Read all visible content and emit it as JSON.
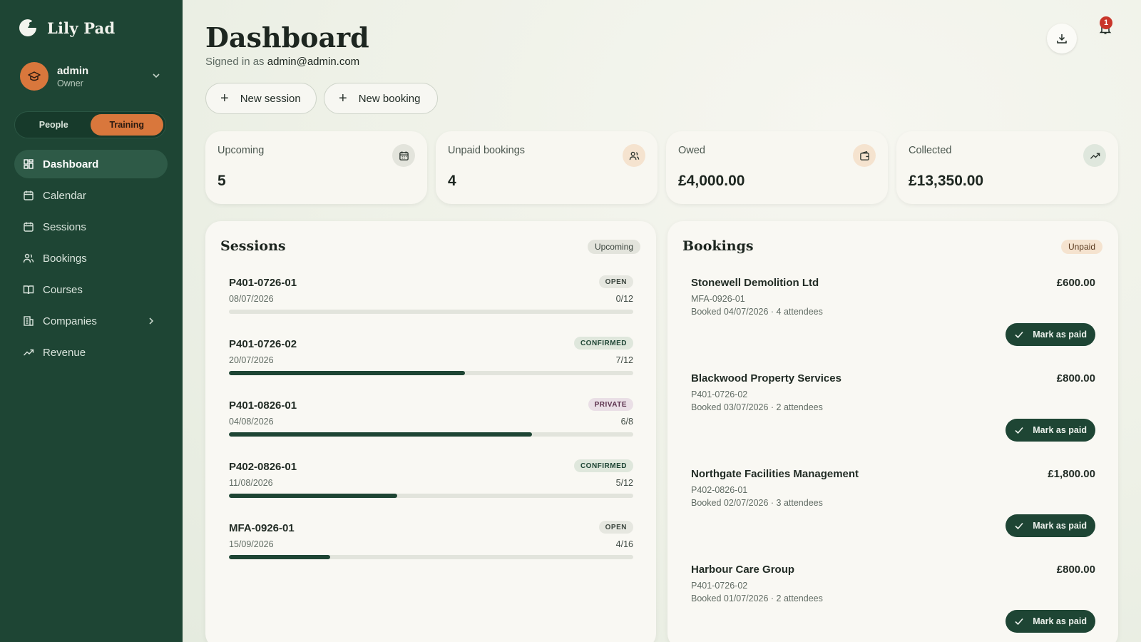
{
  "brand": {
    "name": "Lily Pad"
  },
  "user": {
    "name": "admin",
    "role": "Owner"
  },
  "mode_toggle": {
    "options": [
      "People",
      "Training"
    ],
    "selected": "Training"
  },
  "nav": {
    "items": [
      {
        "label": "Dashboard",
        "icon": "dashboard-icon",
        "active": true
      },
      {
        "label": "Calendar",
        "icon": "calendar-icon"
      },
      {
        "label": "Sessions",
        "icon": "calendar-icon"
      },
      {
        "label": "Bookings",
        "icon": "users-icon"
      },
      {
        "label": "Courses",
        "icon": "book-icon"
      },
      {
        "label": "Companies",
        "icon": "building-icon",
        "expandable": true
      },
      {
        "label": "Revenue",
        "icon": "trending-up-icon"
      }
    ]
  },
  "header": {
    "title": "Dashboard",
    "signed_in_prefix": "Signed in as",
    "signed_in_email": "admin@admin.com",
    "notification_count": "1"
  },
  "actions": {
    "new_session": "New session",
    "new_booking": "New booking"
  },
  "stats": [
    {
      "label": "Upcoming",
      "value": "5",
      "icon": "calendar-icon",
      "icon_bg": "#e3e4dc"
    },
    {
      "label": "Unpaid bookings",
      "value": "4",
      "icon": "users-icon",
      "icon_bg": "#f5e3cf"
    },
    {
      "label": "Owed",
      "value": "£4,000.00",
      "icon": "wallet-icon",
      "icon_bg": "#f5e3cf"
    },
    {
      "label": "Collected",
      "value": "£13,350.00",
      "icon": "trending-up-icon",
      "icon_bg": "#dfe7dd"
    }
  ],
  "sessions_panel": {
    "title": "Sessions",
    "tag": "Upcoming",
    "items": [
      {
        "code": "P401-0726-01",
        "date": "08/07/2026",
        "status": "OPEN",
        "count": "0/12",
        "fill_ratio": 0.0
      },
      {
        "code": "P401-0726-02",
        "date": "20/07/2026",
        "status": "CONFIRMED",
        "count": "7/12",
        "fill_ratio": 0.583
      },
      {
        "code": "P401-0826-01",
        "date": "04/08/2026",
        "status": "PRIVATE",
        "count": "6/8",
        "fill_ratio": 0.75
      },
      {
        "code": "P402-0826-01",
        "date": "11/08/2026",
        "status": "CONFIRMED",
        "count": "5/12",
        "fill_ratio": 0.417
      },
      {
        "code": "MFA-0926-01",
        "date": "15/09/2026",
        "status": "OPEN",
        "count": "4/16",
        "fill_ratio": 0.25
      }
    ]
  },
  "bookings_panel": {
    "title": "Bookings",
    "tag": "Unpaid",
    "pay_label": "Mark as paid",
    "items": [
      {
        "company": "Stonewell Demolition Ltd",
        "session": "MFA-0926-01",
        "meta": "Booked 04/07/2026 · 4 attendees",
        "amount": "£600.00"
      },
      {
        "company": "Blackwood Property Services",
        "session": "P401-0726-02",
        "meta": "Booked 03/07/2026 · 2 attendees",
        "amount": "£800.00"
      },
      {
        "company": "Northgate Facilities Management",
        "session": "P402-0826-01",
        "meta": "Booked 02/07/2026 · 3 attendees",
        "amount": "£1,800.00"
      },
      {
        "company": "Harbour Care Group",
        "session": "P401-0726-02",
        "meta": "Booked 01/07/2026 · 2 attendees",
        "amount": "£800.00"
      }
    ]
  },
  "colors": {
    "sidebar": "#1e4534",
    "accent": "#d9773c",
    "badge_open_bg": "#e6e7e0",
    "badge_confirmed_bg": "#dfe7dc",
    "badge_private_bg": "#eadfe6",
    "tag_unpaid_bg": "#f5e3cf",
    "tag_upcoming_bg": "#e3e4dc"
  }
}
